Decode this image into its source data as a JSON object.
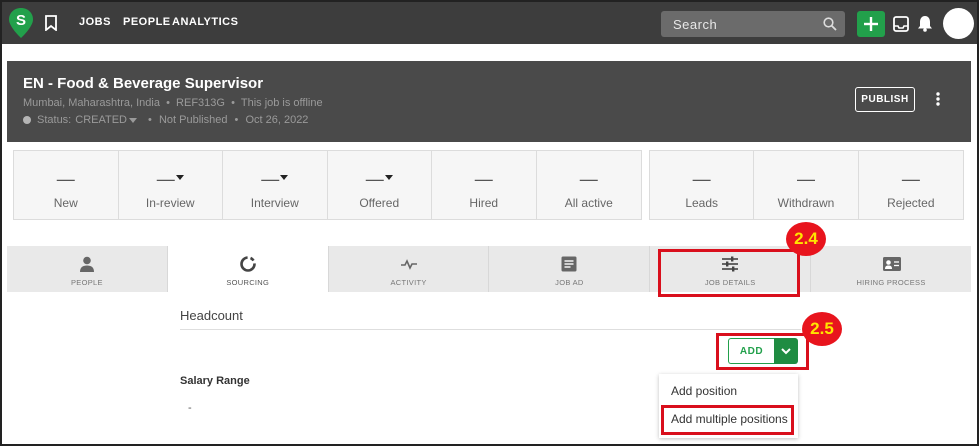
{
  "nav": {
    "links": [
      "JOBS",
      "PEOPLE",
      "ANALYTICS"
    ],
    "search_placeholder": "Search"
  },
  "job": {
    "title": "EN - Food & Beverage Supervisor",
    "location": "Mumbai, Maharashtra, India",
    "ref": "REF313G",
    "online_state": "This job is offline",
    "status_label": "Status:",
    "status_value": "CREATED",
    "publish_state": "Not Published",
    "date": "Oct 26, 2022",
    "publish_button": "PUBLISH"
  },
  "pipeline": [
    {
      "label": "New",
      "value": "—",
      "dropdown": false
    },
    {
      "label": "In-review",
      "value": "—",
      "dropdown": true
    },
    {
      "label": "Interview",
      "value": "—",
      "dropdown": true
    },
    {
      "label": "Offered",
      "value": "—",
      "dropdown": true
    },
    {
      "label": "Hired",
      "value": "—",
      "dropdown": false
    },
    {
      "label": "All active",
      "value": "—",
      "dropdown": false
    }
  ],
  "secondary": [
    {
      "label": "Leads",
      "value": "—"
    },
    {
      "label": "Withdrawn",
      "value": "—"
    },
    {
      "label": "Rejected",
      "value": "—"
    }
  ],
  "tabs": [
    {
      "label": "PEOPLE",
      "icon": "person-icon",
      "active": false
    },
    {
      "label": "SOURCING",
      "icon": "sourcing-ring-icon",
      "active": true
    },
    {
      "label": "ACTIVITY",
      "icon": "activity-pulse-icon",
      "active": false
    },
    {
      "label": "JOB AD",
      "icon": "document-icon",
      "active": false
    },
    {
      "label": "JOB DETAILS",
      "icon": "sliders-icon",
      "active": false
    },
    {
      "label": "HIRING PROCESS",
      "icon": "id-card-icon",
      "active": false
    }
  ],
  "content": {
    "headcount_title": "Headcount",
    "add_button": "ADD",
    "salary_title": "Salary Range",
    "salary_value": "-"
  },
  "dropdown": {
    "items": [
      "Add position",
      "Add multiple positions"
    ]
  },
  "annotations": {
    "badge_job_details": "2.4",
    "badge_add": "2.5"
  },
  "colors": {
    "brand_green": "#22a04b",
    "annotation_red": "#d90f1c",
    "badge_text": "#ffe400"
  }
}
